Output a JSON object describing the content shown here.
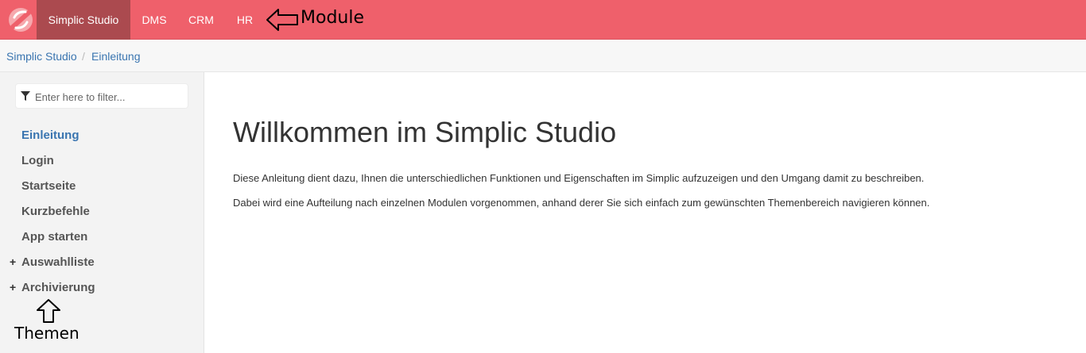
{
  "topnav": {
    "items": [
      {
        "label": "Simplic Studio",
        "active": true
      },
      {
        "label": "DMS",
        "active": false
      },
      {
        "label": "CRM",
        "active": false
      },
      {
        "label": "HR",
        "active": false
      }
    ],
    "logo_icon": "simplic-logo-icon",
    "colors": {
      "bar": "#ef606b",
      "active": "#ab4a4f"
    }
  },
  "annotations": {
    "module": "Module",
    "themen": "Themen"
  },
  "breadcrumb": {
    "items": [
      "Simplic Studio",
      "Einleitung"
    ],
    "separator": "/"
  },
  "sidebar": {
    "filter_placeholder": "Enter here to filter...",
    "filter_icon": "funnel-icon",
    "items": [
      {
        "label": "Einleitung",
        "prefix": "",
        "active": true
      },
      {
        "label": "Login",
        "prefix": "",
        "active": false
      },
      {
        "label": "Startseite",
        "prefix": "",
        "active": false
      },
      {
        "label": "Kurzbefehle",
        "prefix": "",
        "active": false
      },
      {
        "label": "App starten",
        "prefix": "",
        "active": false
      },
      {
        "label": "Auswahlliste",
        "prefix": "+",
        "active": false
      },
      {
        "label": "Archivierung",
        "prefix": "+",
        "active": false
      }
    ]
  },
  "main": {
    "title": "Willkommen im Simplic Studio",
    "paragraphs": [
      "Diese Anleitung dient dazu, Ihnen die unterschiedlichen Funktionen und Eigenschaften im Simplic aufzuzeigen und den Umgang damit zu beschreiben.",
      "Dabei wird eine Aufteilung nach einzelnen Modulen vorgenommen, anhand derer Sie sich einfach zum gewünschten Themenbereich navigieren können."
    ]
  }
}
